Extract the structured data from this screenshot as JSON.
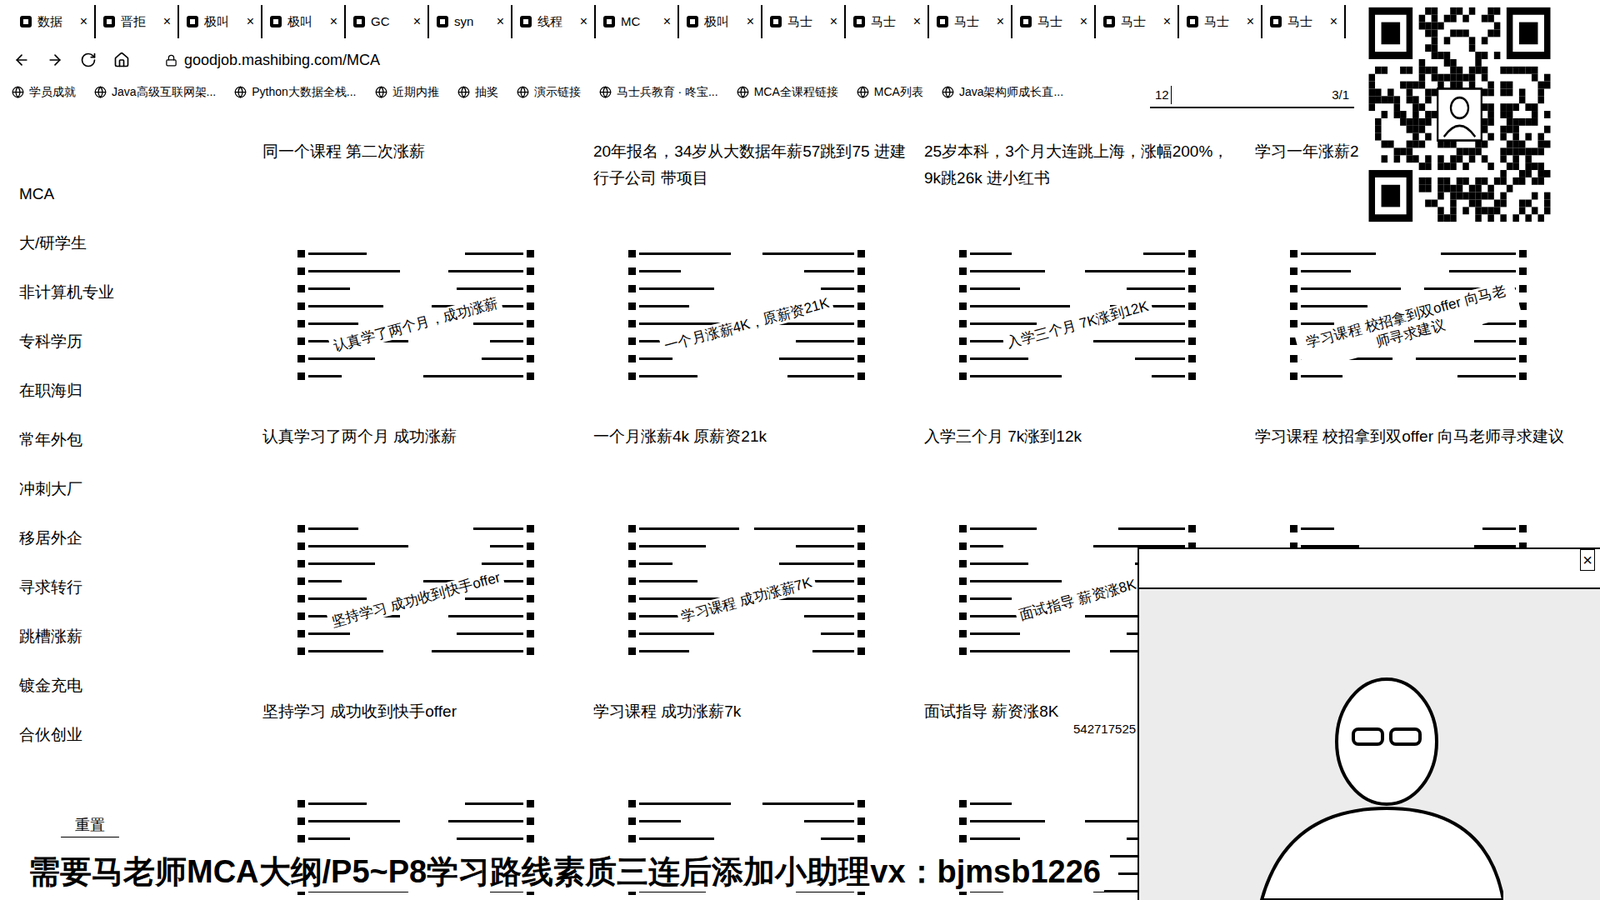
{
  "browser": {
    "tabs": [
      {
        "label": "数据"
      },
      {
        "label": "晋拒"
      },
      {
        "label": "极叫"
      },
      {
        "label": "极叫"
      },
      {
        "label": "GC"
      },
      {
        "label": "syn"
      },
      {
        "label": "线程"
      },
      {
        "label": "MC"
      },
      {
        "label": "极叫"
      },
      {
        "label": "马士"
      },
      {
        "label": "马士"
      },
      {
        "label": "马士"
      },
      {
        "label": "马士"
      },
      {
        "label": "马士"
      },
      {
        "label": "马士"
      },
      {
        "label": "马士"
      }
    ],
    "tab_close": "×",
    "address": "goodjob.mashibing.com/MCA",
    "bookmarks": [
      "学员成就",
      "Java高级互联网架...",
      "Python大数据全栈...",
      "近期内推",
      "抽奖",
      "演示链接",
      "马士兵教育 · 咚宝...",
      "MCA全课程链接",
      "MCA列表",
      "Java架构师成长直..."
    ],
    "find": {
      "query": "12",
      "count": "3/1"
    }
  },
  "sidebar": {
    "items": [
      "MCA",
      "大/研学生",
      "非计算机专业",
      "专科学历",
      "在职海归",
      "常年外包",
      "冲刺大厂",
      "移居外企",
      "寻求转行",
      "跳槽涨薪",
      "镀金充电",
      "合伙创业"
    ],
    "reset": "重置"
  },
  "top_captions": [
    "同一个课程 第二次涨薪",
    "20年报名，34岁从大数据年薪57跳到75 进建行子公司 带项目",
    "25岁本科，3个月大连跳上海，涨幅200%，9k跳26k 进小红书",
    "学习一年涨薪2"
  ],
  "card_rows": [
    [
      {
        "caption": "认真学习了两个月 成功涨薪",
        "stamp": "认真学了两个月，成功涨薪"
      },
      {
        "caption": "一个月涨薪4k 原薪资21k",
        "stamp": "一个月涨薪4K，原薪资21K"
      },
      {
        "caption": "入学三个月 7k涨到12k",
        "stamp": "入学三个月 7K涨到12K"
      },
      {
        "caption": "学习课程 校招拿到双offer 向马老师寻求建议",
        "stamp": "学习课程 校招拿到双offer 向马老师寻求建议"
      }
    ],
    [
      {
        "caption": "坚持学习 成功收到快手offer",
        "stamp": "坚持学习 成功收到快手offer"
      },
      {
        "caption": "学习课程 成功涨薪7k",
        "stamp": "学习课程 成功涨薪7K"
      },
      {
        "caption": "面试指导 薪资涨8K",
        "stamp": "面试指导 薪资涨8K"
      },
      {}
    ],
    [
      {},
      {},
      {},
      {}
    ]
  ],
  "overlay_number": "542717525",
  "video": {
    "close": "×"
  },
  "banner": "需要马老师MCA大纲/P5~P8学习路线素质三连后添加小助理vx：bjmsb1226"
}
